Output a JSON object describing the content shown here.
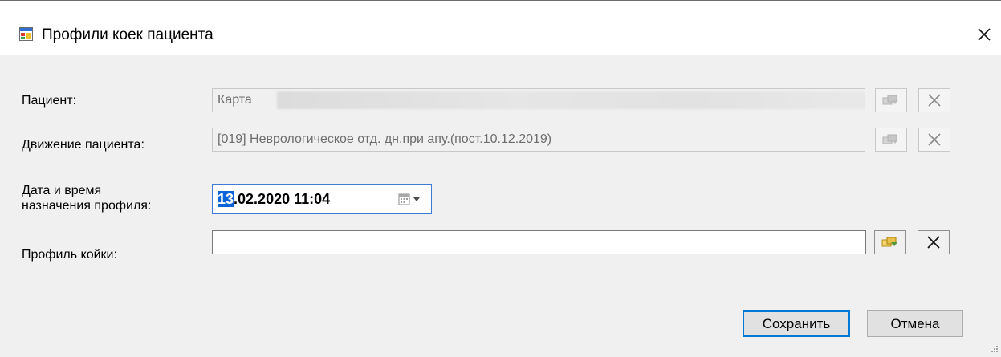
{
  "window": {
    "title": "Профили коек пациента",
    "icon": "form-window-icon",
    "close_icon": "close-icon"
  },
  "form": {
    "patient": {
      "label": "Пациент:",
      "value": "Карта ",
      "value_redacted": true,
      "readonly": true
    },
    "movement": {
      "label": "Движение пациента:",
      "value": "[019] Неврологическое отд. дн.при апу.(пост.10.12.2019)",
      "readonly": true
    },
    "datetime": {
      "label_line1": "Дата и время",
      "label_line2": "назначения профиля:",
      "value_selected": "13",
      "value_rest": ".02.2020 11:04",
      "icon": "calendar-dropdown-icon"
    },
    "bed_profile": {
      "label": "Профиль койки:",
      "value": ""
    }
  },
  "buttons": {
    "save": "Сохранить",
    "cancel": "Отмена"
  },
  "colors": {
    "accent": "#0078d7",
    "selection": "#0a64d8",
    "dialog_bg": "#f0f0f0"
  }
}
